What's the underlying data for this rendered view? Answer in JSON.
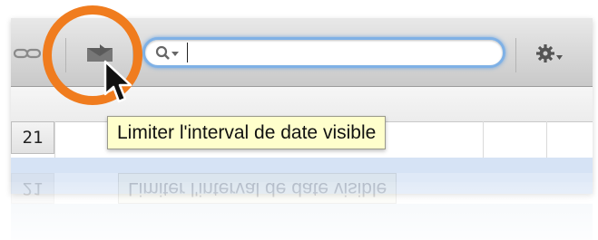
{
  "toolbar": {
    "link_icon": "link-icon",
    "envelope_icon": "envelope-filter-icon",
    "search": {
      "icon": "magnifier-dropdown-icon",
      "value": "",
      "placeholder": ""
    },
    "gear_icon": "gear-dropdown-icon"
  },
  "calendar": {
    "day_number": "21"
  },
  "tooltip": {
    "text": "Limiter l'interval de date visible"
  },
  "annotation": {
    "highlight_color": "#f07c1e",
    "cursor": "arrow-cursor"
  },
  "colors": {
    "tooltip_bg": "#ffffcc",
    "search_focus": "#7fb1e6",
    "selection_row": "#d6e3f5"
  }
}
